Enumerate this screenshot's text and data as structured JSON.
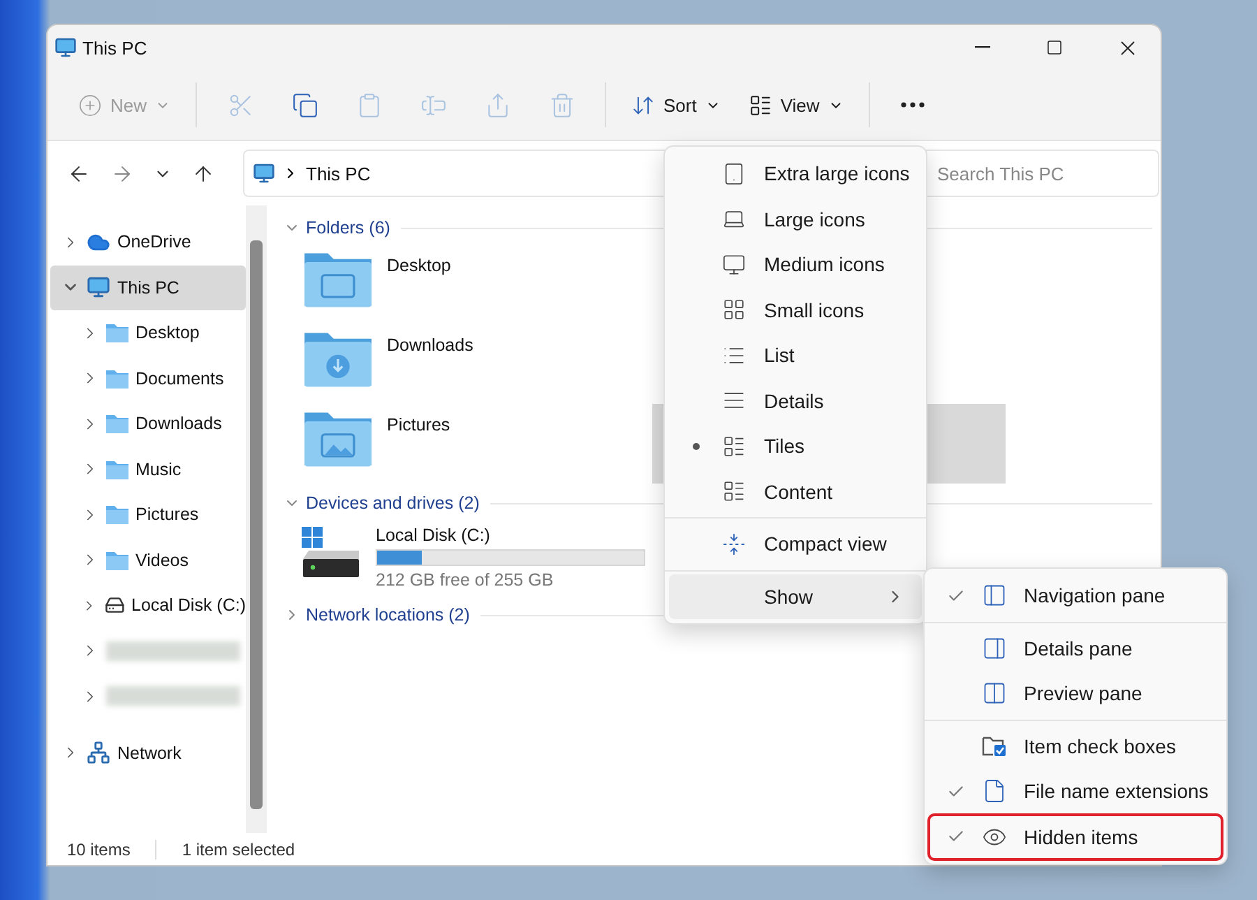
{
  "window": {
    "title": "This PC"
  },
  "toolbar": {
    "new": {
      "label": "New",
      "disabled": true
    },
    "tools": [
      {
        "kind": "cut",
        "disabled": true
      },
      {
        "kind": "copy",
        "disabled": false
      },
      {
        "kind": "paste",
        "disabled": true
      },
      {
        "kind": "rename",
        "disabled": true
      },
      {
        "kind": "share",
        "disabled": true
      },
      {
        "kind": "delete",
        "disabled": true
      }
    ],
    "sort": {
      "label": "Sort"
    },
    "view": {
      "label": "View"
    }
  },
  "address": {
    "path": "This PC"
  },
  "search": {
    "placeholder": "Search This PC"
  },
  "sidebar": {
    "items": [
      {
        "label": "OneDrive",
        "kind": "cloud",
        "expanded": false,
        "selected": false
      },
      {
        "label": "This PC",
        "kind": "pc",
        "expanded": true,
        "selected": true,
        "children": [
          {
            "label": "Desktop",
            "kind": "folder",
            "expanded": false,
            "selected": false
          },
          {
            "label": "Documents",
            "kind": "folder",
            "expanded": false,
            "selected": false
          },
          {
            "label": "Downloads",
            "kind": "folder",
            "expanded": false,
            "selected": false
          },
          {
            "label": "Music",
            "kind": "folder",
            "expanded": false,
            "selected": false
          },
          {
            "label": "Pictures",
            "kind": "folder",
            "expanded": false,
            "selected": false
          },
          {
            "label": "Videos",
            "kind": "folder",
            "expanded": false,
            "selected": false
          },
          {
            "label": "Local Disk (C:)",
            "kind": "disk",
            "expanded": false,
            "selected": false
          },
          {
            "kind": "blurred",
            "expanded": false,
            "selected": false
          },
          {
            "kind": "blurred",
            "expanded": false,
            "selected": false
          }
        ]
      },
      {
        "label": "Network",
        "kind": "network",
        "expanded": false,
        "selected": false
      }
    ]
  },
  "content": {
    "groups": [
      {
        "title": "Folders (6)",
        "kind": "folders",
        "expanded": true,
        "items": [
          {
            "name": "Desktop",
            "kind": "desktop",
            "selected": false
          },
          {
            "kind": "covered",
            "selected": false
          },
          {
            "name": "Downloads",
            "kind": "downloads",
            "selected": false
          },
          {
            "kind": "covered",
            "selected": false
          },
          {
            "name": "Pictures",
            "kind": "pictures",
            "selected": false
          },
          {
            "kind": "covered",
            "selected": true
          }
        ]
      },
      {
        "title": "Devices and drives (2)",
        "kind": "drives",
        "expanded": true,
        "items": [
          {
            "name": "Local Disk (C:)",
            "level": 0.17,
            "free": "212 GB free of 255 GB"
          }
        ]
      },
      {
        "title": "Network locations (2)",
        "expanded": false
      }
    ]
  },
  "view_menu": {
    "layouts": [
      {
        "label": "Extra large icons",
        "kind": "xl",
        "selected": false
      },
      {
        "label": "Large icons",
        "kind": "large",
        "selected": false
      },
      {
        "label": "Medium icons",
        "kind": "medium",
        "selected": false
      },
      {
        "label": "Small icons",
        "kind": "small",
        "selected": false
      },
      {
        "label": "List",
        "kind": "list",
        "selected": false
      },
      {
        "label": "Details",
        "kind": "details",
        "selected": false
      },
      {
        "label": "Tiles",
        "kind": "tiles",
        "selected": true
      },
      {
        "label": "Content",
        "kind": "content",
        "selected": false
      }
    ],
    "compact": {
      "label": "Compact view",
      "checked": false
    },
    "show": {
      "label": "Show",
      "highlighted": true
    }
  },
  "show_menu": {
    "items": [
      {
        "label": "Navigation pane",
        "kind": "nav",
        "checked": true,
        "outlined": false
      },
      {
        "label": "Details pane",
        "kind": "details",
        "checked": false,
        "outlined": false
      },
      {
        "label": "Preview pane",
        "kind": "preview",
        "checked": false,
        "outlined": false
      },
      {
        "label": "Item check boxes",
        "kind": "checkboxes",
        "checked": false,
        "outlined": false
      },
      {
        "label": "File name extensions",
        "kind": "extensions",
        "checked": true,
        "outlined": false
      },
      {
        "label": "Hidden items",
        "kind": "hidden",
        "checked": true,
        "outlined": true
      }
    ]
  },
  "status_bar": {
    "count": "10 items",
    "selection": "1 item selected"
  }
}
